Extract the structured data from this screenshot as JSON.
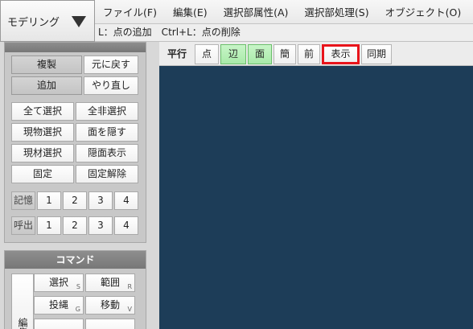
{
  "mode_selector": {
    "value": "モデリング"
  },
  "menubar": {
    "items": [
      "ファイル(F)",
      "編集(E)",
      "選択部属性(A)",
      "選択部処理(S)",
      "オブジェクト(O)"
    ]
  },
  "status_hint": "L：点の追加　Ctrl+L：点の削除",
  "edit_panel": {
    "buttons": {
      "duplicate": "複製",
      "undo": "元に戻す",
      "add": "追加",
      "redo": "やり直し",
      "select_all": "全て選択",
      "deselect_all": "全非選択",
      "select_object": "現物選択",
      "hide_face": "面を隠す",
      "select_material": "現材選択",
      "show_hidden": "隠面表示",
      "fix": "固定",
      "unfix": "固定解除"
    },
    "memory_label": "記憶",
    "recall_label": "呼出",
    "slots": [
      "1",
      "2",
      "3",
      "4"
    ]
  },
  "command_panel": {
    "title": "コマンド",
    "side_label": "編集",
    "buttons": [
      {
        "label": "選択",
        "key": "S"
      },
      {
        "label": "範囲",
        "key": "R"
      },
      {
        "label": "投縄",
        "key": "G"
      },
      {
        "label": "移動",
        "key": "V"
      }
    ]
  },
  "view_toolbar": {
    "parallel_label": "平行",
    "buttons": {
      "point": "点",
      "edge": "辺",
      "face": "面",
      "simple": "簡",
      "front": "前",
      "display": "表示",
      "sync": "同期"
    }
  },
  "colors": {
    "viewport_bg": "#1d3d58",
    "active_toggle": "#a9eaa9",
    "highlight_border": "#e8141b"
  }
}
